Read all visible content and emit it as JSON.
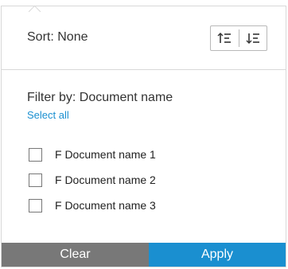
{
  "sort": {
    "label": "Sort: None",
    "ascending_icon": "sort-ascending-icon",
    "descending_icon": "sort-descending-icon"
  },
  "filter": {
    "title": "Filter by: Document name",
    "select_all": "Select all",
    "options": [
      {
        "label": "F Document name 1",
        "checked": false
      },
      {
        "label": "F Document name 2",
        "checked": false
      },
      {
        "label": "F Document name 3",
        "checked": false
      }
    ]
  },
  "footer": {
    "clear_label": "Clear",
    "apply_label": "Apply"
  },
  "colors": {
    "accent": "#1a8fd0",
    "clear_bg": "#787878",
    "border": "#d8d8d8"
  }
}
